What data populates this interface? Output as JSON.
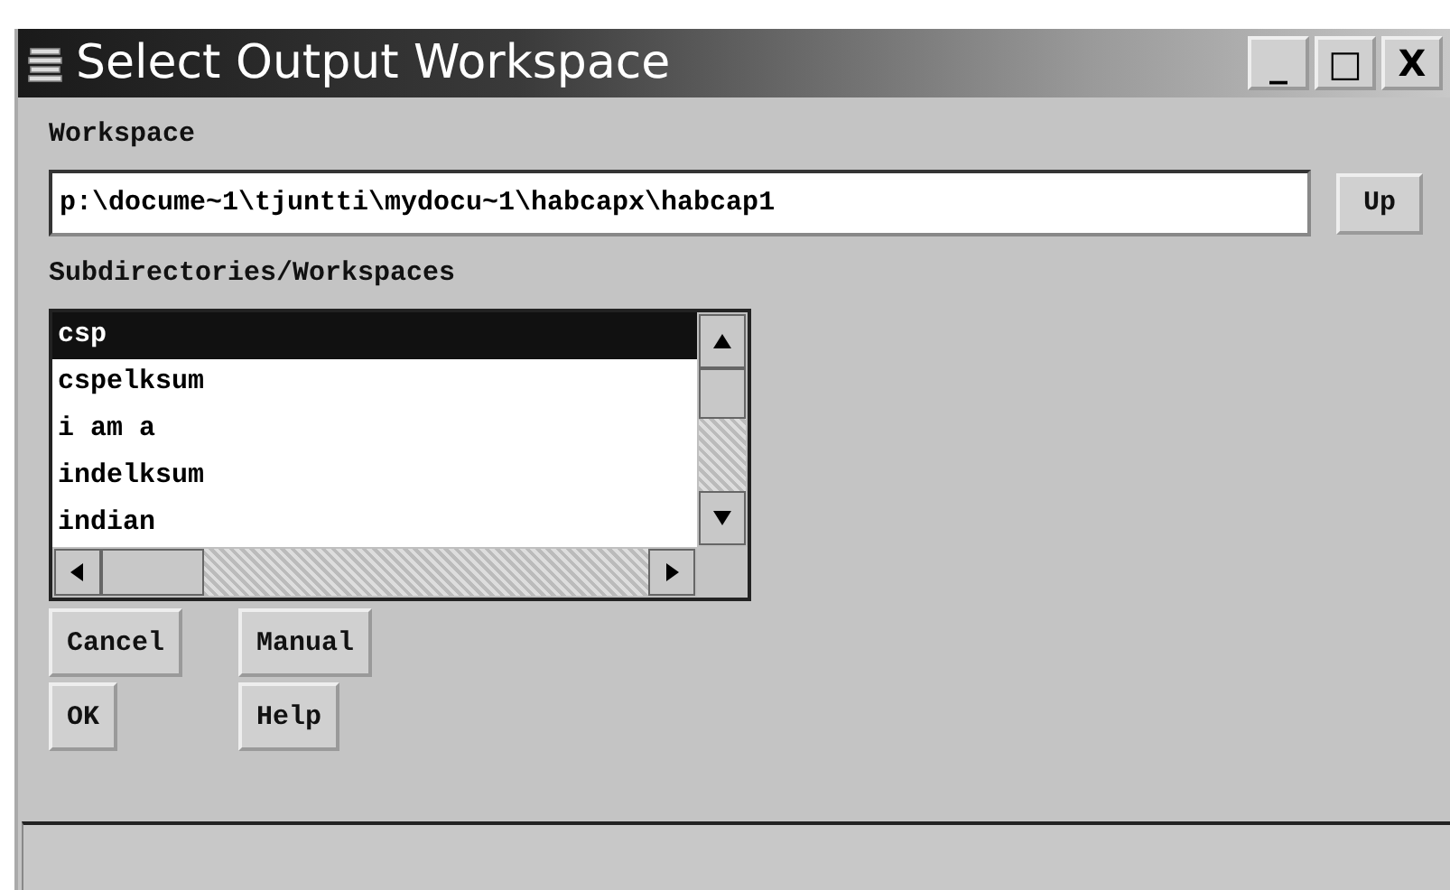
{
  "window": {
    "title": "Select Output Workspace",
    "controls": [
      "_",
      "□",
      "X"
    ]
  },
  "workspace": {
    "label": "Workspace",
    "value": "p:\\docume~1\\tjuntti\\mydocu~1\\habcapx\\habcap1",
    "up_button": "Up"
  },
  "subdirectories": {
    "label": "Subdirectories/Workspaces",
    "items": [
      {
        "label": "csp",
        "selected": true
      },
      {
        "label": "cspelksum",
        "selected": false
      },
      {
        "label": "i am a",
        "selected": false
      },
      {
        "label": "indelksum",
        "selected": false
      },
      {
        "label": "indian",
        "selected": false
      }
    ]
  },
  "buttons": [
    "Cancel",
    "Manual",
    "OK",
    "Help"
  ]
}
